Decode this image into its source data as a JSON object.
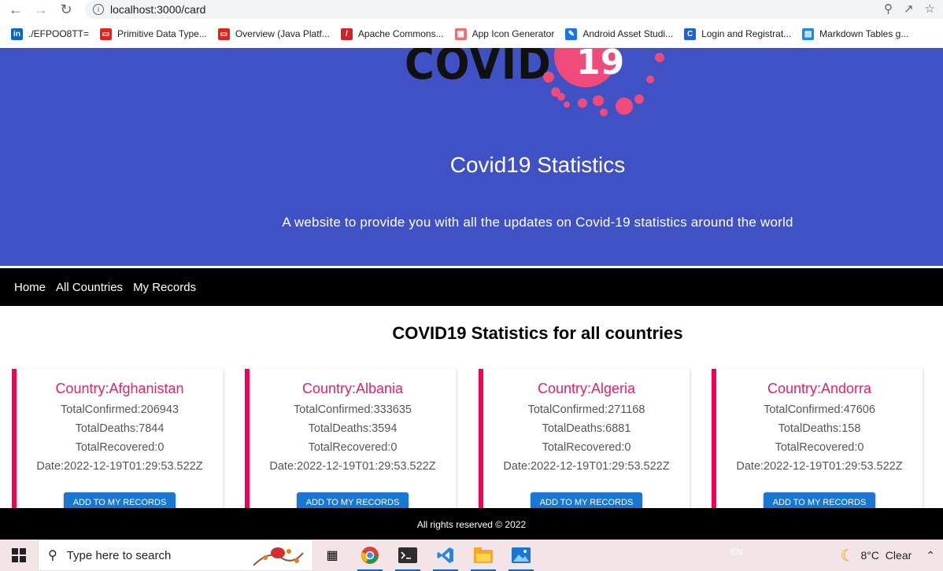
{
  "browser": {
    "url": "localhost:3000/card",
    "bookmarks": [
      {
        "label": "./EFPOO8TT=",
        "icon": "linkedin-icon",
        "color": "#0a66c2"
      },
      {
        "label": "Primitive Data Type...",
        "icon": "oracle-icon",
        "color": "#e2231a"
      },
      {
        "label": "Overview (Java Platf...",
        "icon": "oracle-icon",
        "color": "#e2231a"
      },
      {
        "label": "Apache Commons...",
        "icon": "apache-feather-icon",
        "color": "#d22128"
      },
      {
        "label": "App Icon Generator",
        "icon": "grid-icon",
        "color": "#e57373"
      },
      {
        "label": "Android Asset Studi...",
        "icon": "android-studio-icon",
        "color": "#1a73e8"
      },
      {
        "label": "Login and Registrat...",
        "icon": "c-logo-icon",
        "color": "#1e63d6"
      },
      {
        "label": "Markdown Tables g...",
        "icon": "table-icon",
        "color": "#1e88e5"
      }
    ]
  },
  "hero": {
    "logo_text": "COVID",
    "logo_number": "19",
    "title": "Covid19 Statistics",
    "subtitle": "A website to provide you with all the updates on Covid-19 statistics around the world"
  },
  "nav": {
    "items": [
      "Home",
      "All Countries",
      "My Records"
    ]
  },
  "main": {
    "section_title": "COVID19 Statistics for all countries",
    "cards": [
      {
        "country": "Country:Afghanistan",
        "confirmed": "TotalConfirmed:206943",
        "deaths": "TotalDeaths:7844",
        "recovered": "TotalRecovered:0",
        "date": "Date:2022-12-19T01:29:53.522Z",
        "button": "ADD TO MY RECORDS"
      },
      {
        "country": "Country:Albania",
        "confirmed": "TotalConfirmed:333635",
        "deaths": "TotalDeaths:3594",
        "recovered": "TotalRecovered:0",
        "date": "Date:2022-12-19T01:29:53.522Z",
        "button": "ADD TO MY RECORDS"
      },
      {
        "country": "Country:Algeria",
        "confirmed": "TotalConfirmed:271168",
        "deaths": "TotalDeaths:6881",
        "recovered": "TotalRecovered:0",
        "date": "Date:2022-12-19T01:29:53.522Z",
        "button": "ADD TO MY RECORDS"
      },
      {
        "country": "Country:Andorra",
        "confirmed": "TotalConfirmed:47606",
        "deaths": "TotalDeaths:158",
        "recovered": "TotalRecovered:0",
        "date": "Date:2022-12-19T01:29:53.522Z",
        "button": "ADD TO MY RECORDS"
      }
    ]
  },
  "footer": {
    "text": "All rights reserved © 2022"
  },
  "taskbar": {
    "search_placeholder": "Type here to search",
    "language": "EN",
    "weather": "8°C  Clear"
  },
  "colors": {
    "hero_bg": "#3f51c5",
    "accent": "#f50057",
    "button": "#1976d2",
    "country_text": "#e91e63"
  }
}
